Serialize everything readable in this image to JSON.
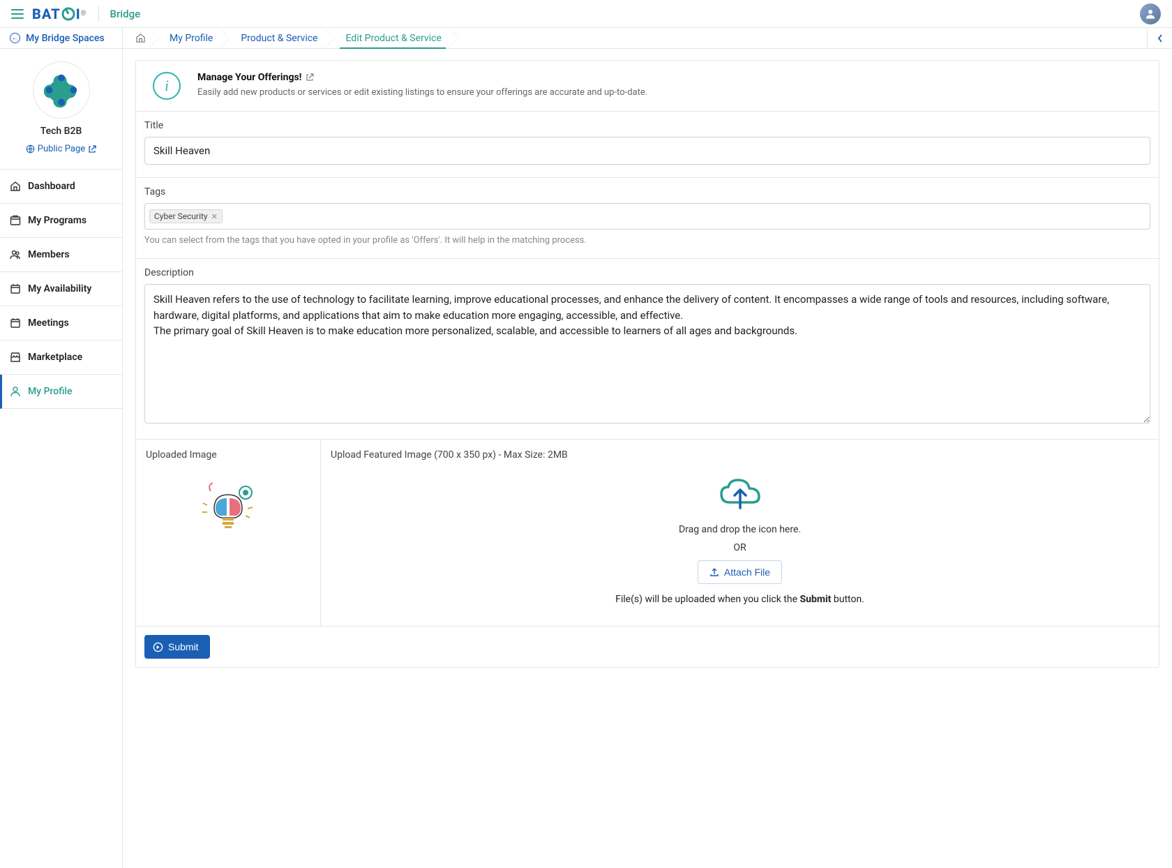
{
  "header": {
    "brand": "BATOI",
    "app": "Bridge"
  },
  "sidebar": {
    "back_label": "My Bridge Spaces",
    "org_name": "Tech B2B",
    "public_page": "Public Page",
    "nav": [
      {
        "label": "Dashboard"
      },
      {
        "label": "My Programs"
      },
      {
        "label": "Members"
      },
      {
        "label": "My Availability"
      },
      {
        "label": "Meetings"
      },
      {
        "label": "Marketplace"
      },
      {
        "label": "My Profile"
      }
    ]
  },
  "breadcrumb": [
    {
      "label": "My Profile"
    },
    {
      "label": "Product & Service"
    },
    {
      "label": "Edit Product & Service"
    }
  ],
  "banner": {
    "title": "Manage Your Offerings!",
    "desc": "Easily add new products or services or edit existing listings to ensure your offerings are accurate and up-to-date."
  },
  "form": {
    "title_label": "Title",
    "title_value": "Skill Heaven",
    "tags_label": "Tags",
    "tags": [
      "Cyber Security"
    ],
    "tags_help": "You can select from the tags that you have opted in your profile as 'Offers'. It will help in the matching process.",
    "desc_label": "Description",
    "desc_value": "Skill Heaven refers to the use of technology to facilitate learning, improve educational processes, and enhance the delivery of content. It encompasses a wide range of tools and resources, including software, hardware, digital platforms, and applications that aim to make education more engaging, accessible, and effective.\nThe primary goal of Skill Heaven is to make education more personalized, scalable, and accessible to learners of all ages and backgrounds.",
    "uploaded_label": "Uploaded Image",
    "upload_label": "Upload Featured Image (700 x 350 px) - Max Size: 2MB",
    "drop_text": "Drag and drop the icon here.",
    "or_text": "OR",
    "attach_label": "Attach File",
    "upload_note_pre": "File(s) will be uploaded when you click the ",
    "upload_note_bold": "Submit",
    "upload_note_post": " button.",
    "submit_label": "Submit"
  }
}
